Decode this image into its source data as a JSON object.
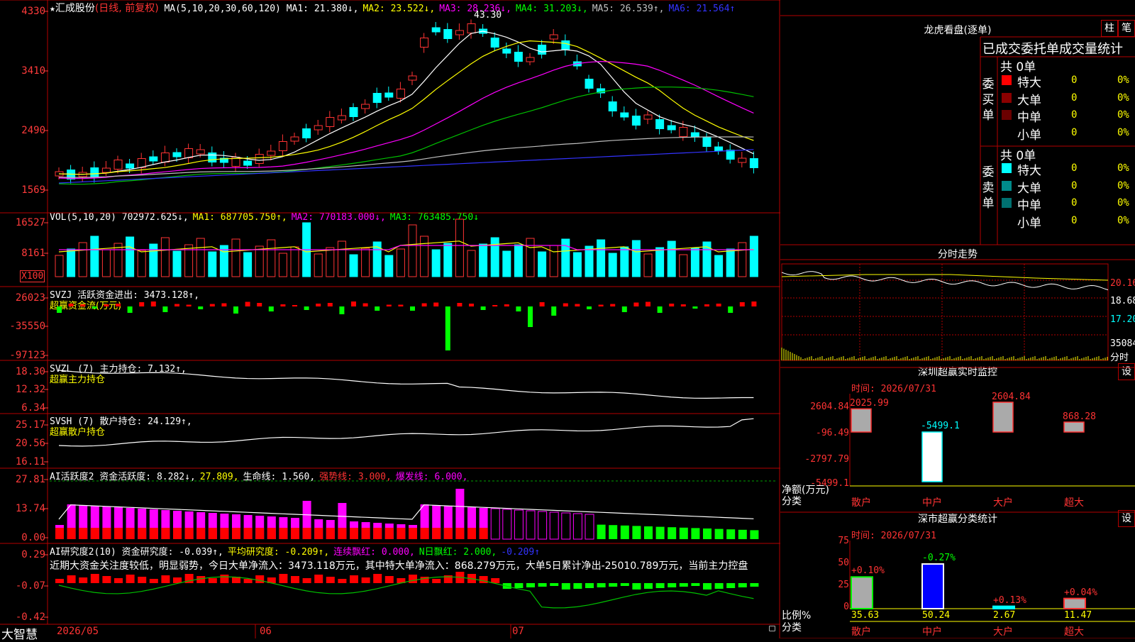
{
  "header": {
    "star": "★",
    "stock_name": "汇成股份",
    "mode": "(日线, 前复权)",
    "ma_label": "MA(5,10,20,30,60,120)",
    "ma_values": [
      {
        "text": "MA1: 21.380↓,",
        "color": "#ffffff"
      },
      {
        "text": "MA2: 23.522↓,",
        "color": "#ffff00"
      },
      {
        "text": "MA3: 28.236↓,",
        "color": "#ff00ff"
      },
      {
        "text": "MA4: 31.203↓,",
        "color": "#00ff00"
      },
      {
        "text": "MA5: 26.539↑,",
        "color": "#c0c0c0"
      },
      {
        "text": "MA6: 21.564↑",
        "color": "#3333ff"
      }
    ],
    "peak_label": "43.30"
  },
  "price_axis": [
    "4330",
    "3410",
    "2490",
    "1569"
  ],
  "vol_panel": {
    "label": "VOL(5,10,20)",
    "items": [
      {
        "text": "702972.625↓,",
        "color": "#ffffff"
      },
      {
        "text": "MA1: 687705.750↑,",
        "color": "#ffff00"
      },
      {
        "text": "MA2: 770183.000↓,",
        "color": "#ff00ff"
      },
      {
        "text": "MA3: 763485.750↓",
        "color": "#00ff00"
      }
    ],
    "axis": [
      "16527",
      "8161"
    ],
    "unit": "X100"
  },
  "svzj_panel": {
    "label": "SVZJ  活跃资金进出: 3473.128↑,",
    "sub": "超赢资金流(万元)",
    "axis": [
      "26023",
      "-35550",
      "-97123"
    ]
  },
  "svzl_panel": {
    "label": "SVZL (7) 主力持仓: 7.132↑,",
    "sub": "超赢主力持仓",
    "axis": [
      "18.30",
      "12.32",
      "6.34"
    ]
  },
  "svsh_panel": {
    "label": "SVSH (7) 散户持仓: 24.129↑,",
    "sub": "超赢散户持仓",
    "axis": [
      "25.17",
      "20.56",
      "16.11"
    ]
  },
  "ai_active_panel": {
    "items": [
      {
        "text": "AI活跃度2 资金活跃度: 8.282↓,",
        "color": "#ffffff"
      },
      {
        "text": "27.809,",
        "color": "#ffff00"
      },
      {
        "text": "生命线: 1.560,",
        "color": "#ffffff"
      },
      {
        "text": "强势线: 3.000,",
        "color": "#ff3333"
      },
      {
        "text": "爆发线: 6.000,",
        "color": "#ff00ff"
      }
    ],
    "axis": [
      "27.81",
      "13.74",
      "0.00"
    ]
  },
  "ai_research_panel": {
    "items": [
      {
        "text": "AI研究度2(10) 资金研究度: -0.039↑,",
        "color": "#ffffff"
      },
      {
        "text": "平均研究度: -0.209↑,",
        "color": "#ffff00"
      },
      {
        "text": "连续飘红: 0.000,",
        "color": "#ff00ff"
      },
      {
        "text": "N日飘红: 2.000,",
        "color": "#00ff00"
      },
      {
        "text": "-0.209↑",
        "color": "#3333ff"
      }
    ],
    "comment": "近期大资金关注度较低，明显弱势，今日大单净流入：3473.118万元，其中特大单净流入：868.279万元，大单5日累计净出-25010.789万元，当前主力控盘",
    "axis": [
      "0.29",
      "-0.07",
      "-0.42"
    ]
  },
  "bottom": {
    "brand": "大智慧",
    "dates": [
      "2026/05",
      "06",
      "07"
    ]
  },
  "right": {
    "dragon_title": "龙虎看盘(逐单)",
    "btn_bar": "柱",
    "btn_stroke": "笔",
    "table_title": "已成交委托单成交量统计",
    "buy": {
      "side_label": "委买单",
      "total": "共 0单",
      "rows": [
        {
          "color": "#ff0000",
          "label": "特大",
          "count": "0",
          "pct": "0%"
        },
        {
          "color": "#8b0000",
          "label": "大单",
          "count": "0",
          "pct": "0%"
        },
        {
          "color": "#6b0000",
          "label": "中单",
          "count": "0",
          "pct": "0%"
        },
        {
          "color": "#000000",
          "label": "小单",
          "count": "0",
          "pct": "0%"
        }
      ]
    },
    "sell": {
      "side_label": "委卖单",
      "total": "共 0单",
      "rows": [
        {
          "color": "#00ffff",
          "label": "特大",
          "count": "0",
          "pct": "0%"
        },
        {
          "color": "#008b8b",
          "label": "大单",
          "count": "0",
          "pct": "0%"
        },
        {
          "color": "#007070",
          "label": "中单",
          "count": "0",
          "pct": "0%"
        },
        {
          "color": "#000000",
          "label": "小单",
          "count": "0",
          "pct": "0%"
        }
      ]
    },
    "fenshi": {
      "title": "分时走势",
      "axis": [
        "20.16",
        "18.68",
        "17.20"
      ],
      "vol_axis": "35084",
      "vol_unit": "分时"
    },
    "monitor": {
      "title": "深圳超赢实时监控",
      "btn": "设",
      "time": "时间: 2026/07/31",
      "axis": [
        "2604.84",
        "-96.49",
        "-2797.79",
        "-5499.1"
      ],
      "axis_title": "净额(万元)",
      "cat_label": "分类",
      "categories": [
        "散户",
        "中户",
        "大户",
        "超大"
      ],
      "values": [
        2025.99,
        -5499.1,
        2604.84,
        868.28
      ],
      "value_labels": [
        "2025.99",
        "-5499.1",
        "2604.84",
        "868.28"
      ]
    },
    "classify": {
      "title": "深市超赢分类统计",
      "btn": "设",
      "time": "时间: 2026/07/31",
      "axis": [
        "75",
        "50",
        "25",
        "0"
      ],
      "axis_title": "比例%",
      "cat_label": "分类",
      "categories": [
        "散户",
        "中户",
        "大户",
        "超大"
      ],
      "values": [
        35.63,
        50.24,
        2.67,
        11.47
      ],
      "value_labels": [
        "35.63",
        "50.24",
        "2.67",
        "11.47"
      ],
      "changes": [
        "+0.10%",
        "-0.27%",
        "+0.13%",
        "+0.04%"
      ]
    }
  }
}
